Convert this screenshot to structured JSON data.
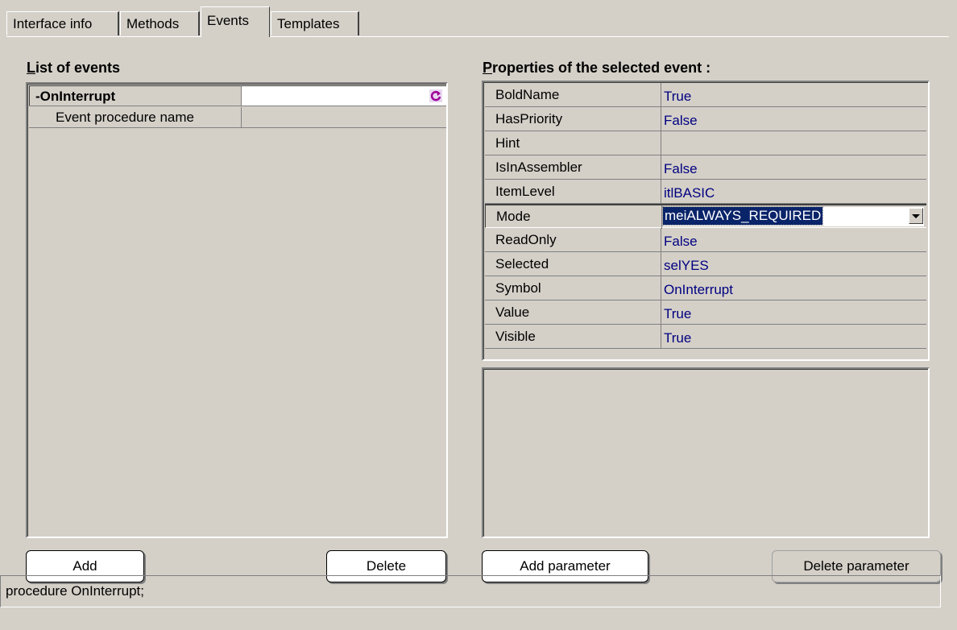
{
  "tabs": [
    {
      "label": "Interface info"
    },
    {
      "label": "Methods"
    },
    {
      "label": "Events"
    },
    {
      "label": "Templates"
    }
  ],
  "events_panel": {
    "heading_first": "L",
    "heading_rest": "ist of events",
    "event_name": "-OnInterrupt",
    "event_value": "",
    "sub_item_label": "Event procedure name",
    "sub_item_value": "",
    "add_label": "Add",
    "delete_label": "Delete"
  },
  "properties_panel": {
    "heading_first": "P",
    "heading_rest": "roperties of the selected event :",
    "rows": [
      {
        "name": "BoldName",
        "value": "True"
      },
      {
        "name": "HasPriority",
        "value": "False"
      },
      {
        "name": "Hint",
        "value": ""
      },
      {
        "name": "IsInAssembler",
        "value": "False"
      },
      {
        "name": "ItemLevel",
        "value": "itlBASIC"
      },
      {
        "name": "Mode",
        "value": "meiALWAYS_REQUIRED"
      },
      {
        "name": "ReadOnly",
        "value": "False"
      },
      {
        "name": "Selected",
        "value": "selYES"
      },
      {
        "name": "Symbol",
        "value": "OnInterrupt"
      },
      {
        "name": "Value",
        "value": "True"
      },
      {
        "name": "Visible",
        "value": "True"
      }
    ],
    "add_param_label": "Add parameter",
    "delete_param_label": "Delete parameter"
  },
  "status_text": "procedure OnInterrupt;",
  "colors": {
    "background": "#d4d0c8",
    "value_text": "#000080",
    "selection": "#0a246a"
  }
}
